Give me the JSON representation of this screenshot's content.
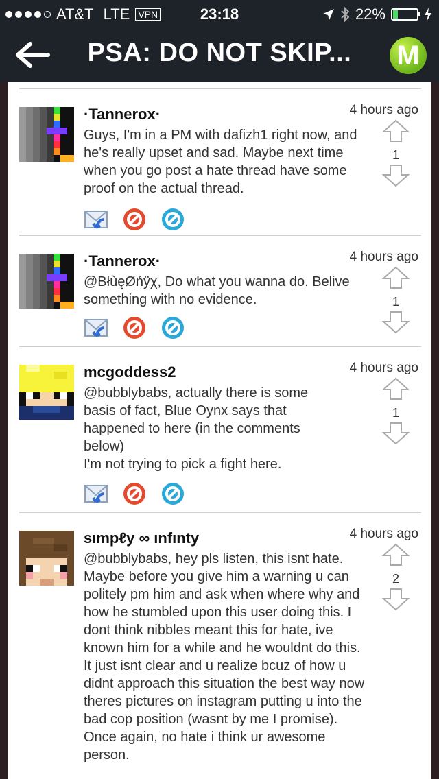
{
  "status_bar": {
    "carrier": "AT&T",
    "network": "LTE",
    "vpn": "VPN",
    "time": "23:18",
    "battery": "22%",
    "battery_level": 0.22
  },
  "nav": {
    "title": "PSA: DO NOT SKIP...",
    "logo_letter": "M"
  },
  "posts": [
    {
      "username": "·Tannerox·",
      "time": "4 hours ago",
      "text": "Guys, I'm in a PM with dafizh1 right now, and he's really upset and sad. Maybe next time when you go post a hate thread have some proof on the actual thread.",
      "votes": "1"
    },
    {
      "username": "·Tannerox·",
      "time": "4 hours ago",
      "text": "@BłùęØńÿχ, Do what you wanna do. Belive something with no evidence.",
      "votes": "1"
    },
    {
      "username": "mcgoddess2",
      "time": "4 hours ago",
      "text": "@bubblybabs, actually there is some basis of fact, Blue Oynx says that happened to here (in the comments below)\nI'm not trying to pick a fight here.",
      "votes": "1"
    },
    {
      "username": "sımpℓy ∞ ınfınty",
      "time": "4 hours ago",
      "text": "@bubblybabs, hey pls listen, this isnt hate. Maybe before you give him a warning u can politely pm him and ask when where why and how he stumbled upon this user doing this. I dont think nibbles meant this for hate, ive known him for a while and he wouldnt do this. It just isnt clear and u realize bcuz of how u didnt approach this situation the best way now theres pictures on instagram putting u into the bad cop position (wasnt by me I promise). Once again, no hate i think ur awesome person.",
      "votes": "2"
    }
  ],
  "icons": {
    "reply": "reply-mail-icon",
    "block": "block-icon",
    "report": "report-icon",
    "upvote": "upvote-arrow-icon",
    "downvote": "downvote-arrow-icon"
  },
  "colors": {
    "bar_bg": "#1e2229",
    "logo_green": "#7cc21f",
    "block_red": "#e64a2e",
    "report_blue": "#2aa8d8"
  }
}
